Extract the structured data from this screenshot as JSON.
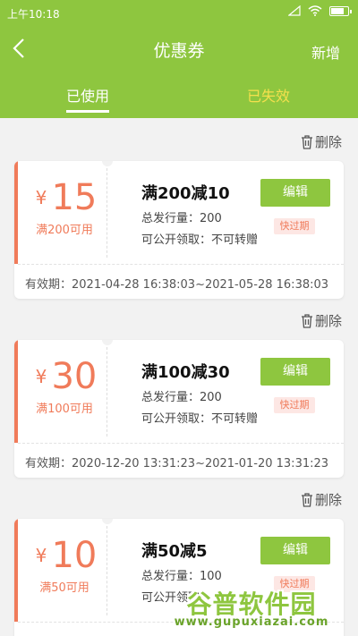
{
  "status": {
    "time": "上午10:18"
  },
  "header": {
    "title": "优惠券",
    "add_label": "新增"
  },
  "tabs": [
    {
      "label": "已使用"
    },
    {
      "label": "已失效"
    }
  ],
  "delete_label": "删除",
  "coupons": [
    {
      "currency": "¥",
      "amount": "15",
      "condition_short": "满200可用",
      "name": "满200减10",
      "issued": "总发行量：200",
      "public": "可公开领取：不可转赠",
      "edit_label": "编辑",
      "badge": "快过期",
      "validity": "有效期：2021-04-28 16:38:03~2021-05-28 16:38:03"
    },
    {
      "currency": "¥",
      "amount": "30",
      "condition_short": "满100可用",
      "name": "满100减30",
      "issued": "总发行量：200",
      "public": "可公开领取：不可转赠",
      "edit_label": "编辑",
      "badge": "快过期",
      "validity": "有效期：2020-12-20 13:31:23~2021-01-20 13:31:23"
    },
    {
      "currency": "¥",
      "amount": "10",
      "condition_short": "满50可用",
      "name": "满50减5",
      "issued": "总发行量：100",
      "public": "可公开领取",
      "edit_label": "编辑",
      "badge": "快过期",
      "validity": ""
    }
  ],
  "watermark": {
    "text": "谷普软件园",
    "url": "www.gupuxiazai.com"
  },
  "colors": {
    "primary": "#8ec63f",
    "accent": "#f07b5a",
    "tab_inactive": "#f4e04d"
  }
}
